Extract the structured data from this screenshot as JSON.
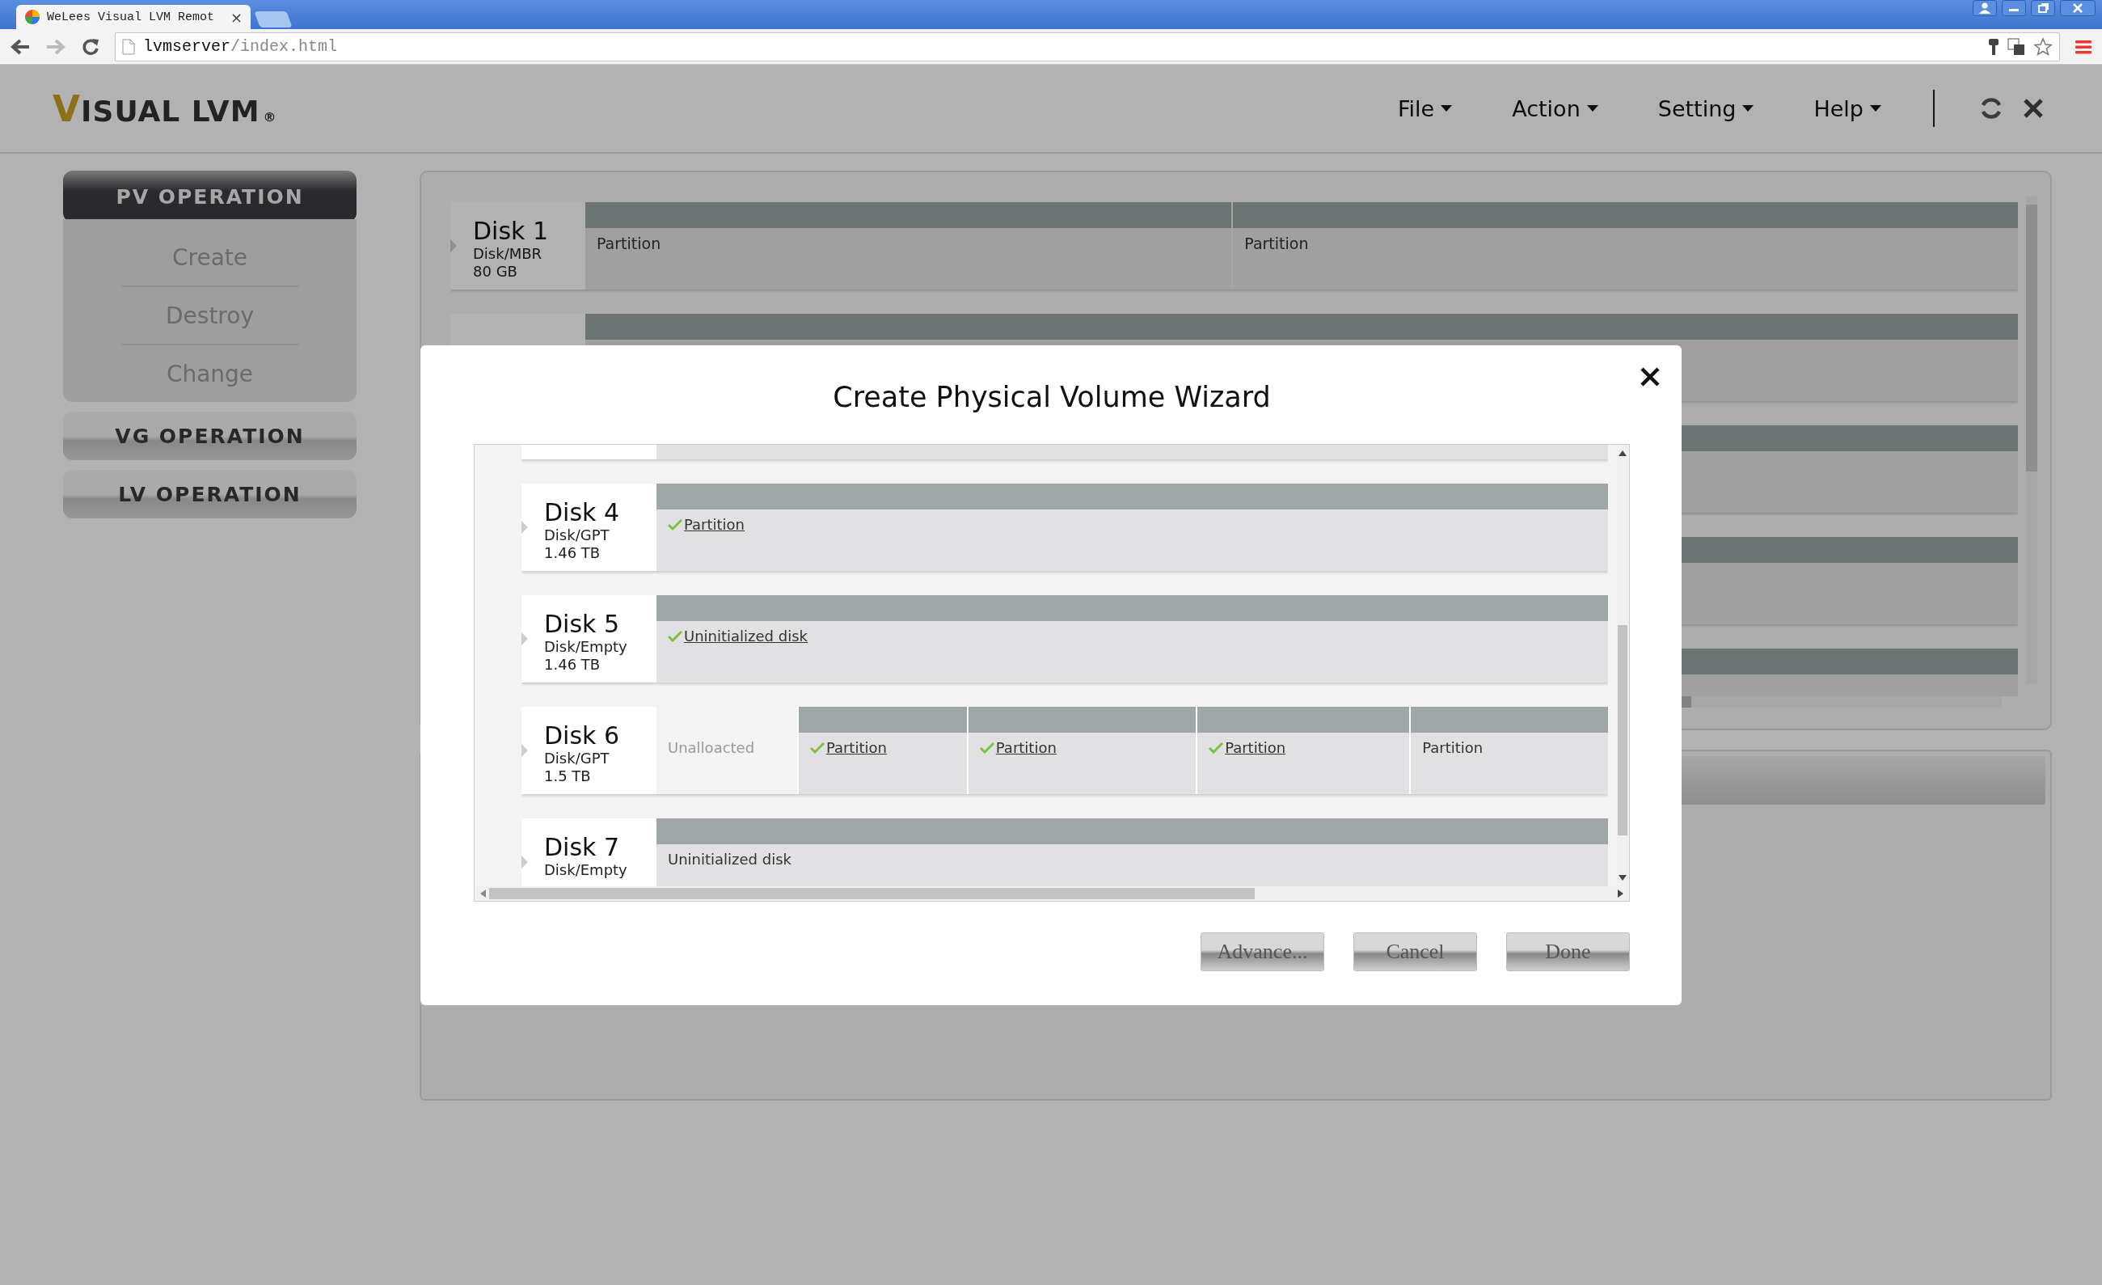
{
  "browser": {
    "tab_title": "WeLees Visual LVM Remot",
    "tab_close": "×",
    "url_host": "lvmserver",
    "url_path": "/index.html"
  },
  "app": {
    "logo": {
      "text": "VISUAL LVM",
      "mark": "®"
    },
    "menu": [
      {
        "label": "File"
      },
      {
        "label": "Action"
      },
      {
        "label": "Setting"
      },
      {
        "label": "Help"
      }
    ]
  },
  "sidebar": [
    {
      "label": "PV OPERATION",
      "expanded": true,
      "items": [
        "Create",
        "Destroy",
        "Change"
      ]
    },
    {
      "label": "VG OPERATION",
      "expanded": false
    },
    {
      "label": "LV OPERATION",
      "expanded": false
    }
  ],
  "background_disks": [
    {
      "name": "Disk 1",
      "type": "Disk/MBR",
      "size": "80 GB",
      "partitions": [
        {
          "label": "Partition"
        },
        {
          "label": "Partition"
        }
      ]
    }
  ],
  "dialog": {
    "title": "Create Physical Volume Wizard",
    "disks": [
      {
        "name": "Disk 4",
        "type": "Disk/GPT",
        "size": "1.46 TB",
        "partitions": [
          {
            "kind": "partition",
            "label": "Partition",
            "checked": true
          }
        ]
      },
      {
        "name": "Disk 5",
        "type": "Disk/Empty",
        "size": "1.46 TB",
        "partitions": [
          {
            "kind": "partition",
            "label": "Uninitialized disk",
            "checked": true
          }
        ]
      },
      {
        "name": "Disk 6",
        "type": "Disk/GPT",
        "size": "1.5 TB",
        "partitions": [
          {
            "kind": "unallocated",
            "label": "Unalloacted",
            "checked": false
          },
          {
            "kind": "partition",
            "label": "Partition",
            "checked": true
          },
          {
            "kind": "partition",
            "label": "Partition",
            "checked": true
          },
          {
            "kind": "partition",
            "label": "Partition",
            "checked": true
          },
          {
            "kind": "partition",
            "label": "Partition",
            "checked": false
          }
        ]
      },
      {
        "name": "Disk 7",
        "type": "Disk/Empty",
        "partitions": [
          {
            "kind": "partition",
            "label": "Uninitialized disk",
            "checked": false
          }
        ]
      }
    ],
    "buttons": [
      {
        "label": "Advance..."
      },
      {
        "label": "Cancel"
      },
      {
        "label": "Done"
      }
    ]
  }
}
